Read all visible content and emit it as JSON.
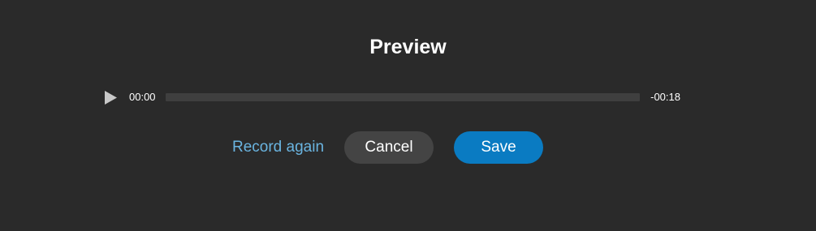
{
  "dialog": {
    "title": "Preview"
  },
  "player": {
    "play_icon": "play-icon",
    "current_time": "00:00",
    "remaining_time": "-00:18",
    "progress": 0
  },
  "actions": {
    "record_again_label": "Record again",
    "cancel_label": "Cancel",
    "save_label": "Save"
  },
  "colors": {
    "background": "#2a2a2a",
    "link": "#6ab4e0",
    "primary": "#0a7bc2",
    "secondary": "#444444"
  }
}
